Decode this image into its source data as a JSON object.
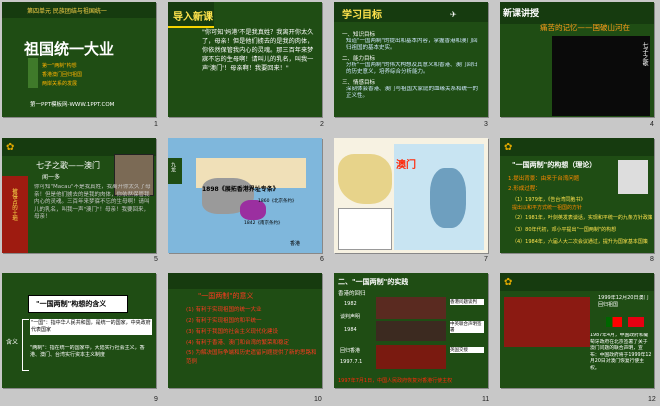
{
  "slides": [
    {
      "number": "1",
      "unit": "第四单元 民族团结与祖国统一",
      "title": "祖国统一大业",
      "items": [
        "第一\"两制\"构想",
        "香港澳门回归祖国",
        "两岸关系的发展"
      ],
      "footer": "第一PPT模板网-WWW.1PPT.COM"
    },
    {
      "number": "2",
      "heading": "导入新课",
      "body": "\"你可知'妈港'不是我真姓？我离开你太久了，母亲！但是他们掳去的是我的肉体，你依然保管我内心的灵魂。那三百年来梦寐不忘的生母啊！请叫儿的乳名，叫我一声'澳门'！母亲啊！我要回来！\""
    },
    {
      "number": "3",
      "heading": "学习目标",
      "lines": [
        "一、知识目标",
        "知道\"一国两制\"的提出和基本内容，掌握香港和澳门回归祖国的基本史实。",
        "二、能力目标",
        "分析\"一国两制\"的伟大构想及其意义和香港、澳门回归的历史意义，培养综合分析能力。",
        "三、情感目标",
        "深刻体会香港、澳门与祖国大家庭的血缘关系和统一的正义性。"
      ]
    },
    {
      "number": "4",
      "heading": "新课讲授",
      "subtitle": "痛苦的记忆——国破山河在",
      "vertical": "七子之歌"
    },
    {
      "number": "5",
      "title": "七子之歌——澳门",
      "author": "闻一多",
      "body": "你可知\"Macau\"不是我真姓，我离开你太久了母亲！但是他们掳去的是我的肉体，你依然保管我内心的灵魂。三百年来梦寐不忘的生母啊！请叫儿的乳名，叫我一声\"澳门\"！母亲！我要回来，母亲！",
      "side_text": "被侵占的土地"
    },
    {
      "number": "6",
      "map_title": "1898《展拓香港界址专条》",
      "labels": [
        "1860《北京条约》",
        "1842《南京条约》",
        "香港"
      ],
      "side_badge": "九龙"
    },
    {
      "number": "7",
      "map_label": "澳门"
    },
    {
      "number": "8",
      "title": "\"一国两制\"的构想（理论）",
      "lines": [
        "1.提出背景：由来于台湾问题",
        "2.形成过程：",
        "（1）1979年，《告台湾同胞书》",
        "提出以和平方式统一祖国的方针",
        "（2）1981年，叶剑英发表谈话，实现和平统一的九条方针政策",
        "（3）80年代初，邓小平提出\"一国两制\"的构想",
        "（4）1984年，六届人大二次会议通过，提升为国家基本国策"
      ]
    },
    {
      "number": "9",
      "box_title": "\"一国两制\"构想的含义",
      "side": "含义",
      "lines": [
        "\"一国\"：指中华人民共和国，是统一的国家，中央政府代表国家",
        "\"两制\"：指在统一的国家中，大陆实行社会主义，香港、澳门、台湾实行资本主义制度"
      ]
    },
    {
      "number": "10",
      "heading": "\"一国两制\"的意义",
      "lines": [
        "(1) 有利于实现祖国的统一大业",
        "(2) 有利于实现祖国的和平统一",
        "(3) 有利于我国的社会主义现代化建设",
        "(4) 有利于香港、澳门和台湾的繁荣和稳定",
        "(5) 为解决国际争端和历史遗留问题提供了新的思路和范例"
      ]
    },
    {
      "number": "11",
      "title": "二、\"一国两制\"的实践",
      "subtitle": "香港的回归",
      "timeline": [
        "1982",
        "谈判声明",
        "1984",
        "回归香港",
        "1997.7.1"
      ],
      "notes": [
        "香港问题谈判",
        "中英联合声明签署",
        "英国交接"
      ],
      "footer": "1997年7月1日，中国人民政府恢复对香港行使主权"
    },
    {
      "number": "12",
      "caption": "1999年12月20日澳门回归祖国",
      "body": "1987年4月，中国政府和葡萄牙政府在北京签署了关于澳门问题的联合声明，宣布：中国政府将于1999年12月20日对澳门恢复行使主权。"
    }
  ],
  "colors": {
    "green": "#1f4d14",
    "dark_green": "#163b0f",
    "red": "#9e1b10",
    "orange": "#ff8a00",
    "gold": "#f5d300"
  }
}
